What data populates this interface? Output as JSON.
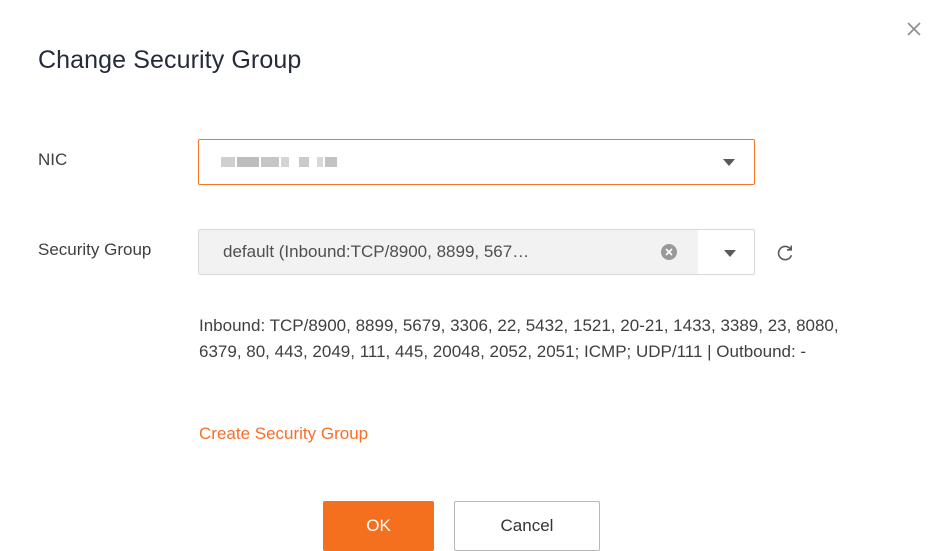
{
  "dialog": {
    "title": "Change Security Group",
    "close_icon": "close-icon"
  },
  "nic": {
    "label": "NIC",
    "value_masked": true,
    "caret_icon": "chevron-down-icon"
  },
  "security_group": {
    "label": "Security Group",
    "value": "default (Inbound:TCP/8900, 8899, 567…",
    "clear_icon": "clear-circle-icon",
    "caret_icon": "chevron-down-icon",
    "refresh_icon": "refresh-icon",
    "rules": "Inbound: TCP/8900, 8899, 5679, 3306, 22, 5432, 1521, 20-21, 1433, 3389, 23, 8080, 6379, 80, 443, 2049, 111, 445, 20048, 2052, 2051; ICMP; UDP/111 | Outbound: -",
    "create_link": "Create Security Group"
  },
  "footer": {
    "ok_label": "OK",
    "cancel_label": "Cancel"
  },
  "colors": {
    "accent": "#f4701e",
    "link": "#f66f28",
    "focus_border": "#f6732a"
  }
}
